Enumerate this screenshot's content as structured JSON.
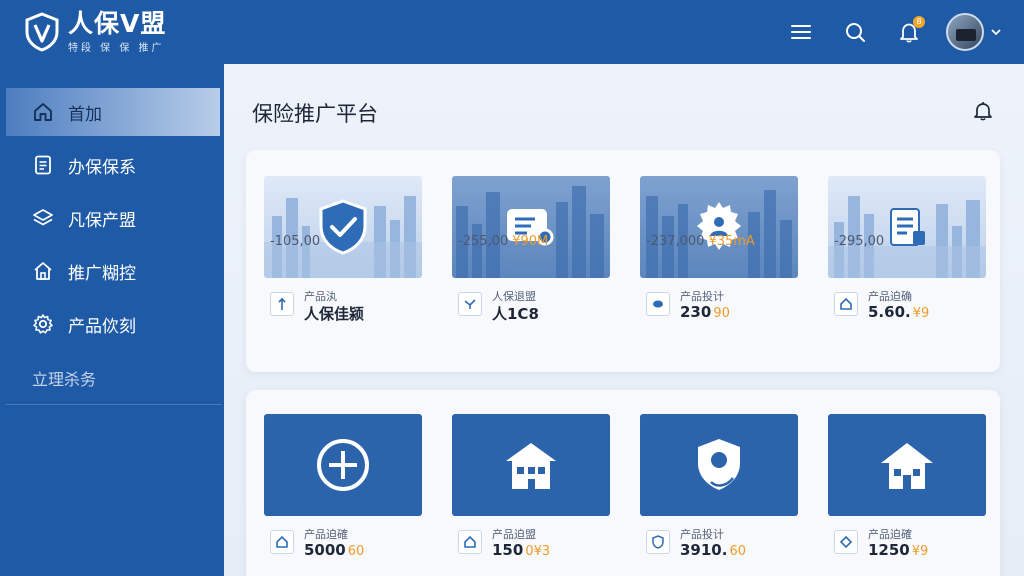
{
  "header": {
    "logo_title": "人保V盟",
    "logo_subtitle": "特段 保 保 推广",
    "icons": [
      "menu-icon",
      "search-icon",
      "bell-icon",
      "avatar",
      "chevron-down-icon"
    ],
    "notification_badge": "8"
  },
  "sidebar": {
    "items": [
      {
        "label": "首加",
        "icon": "home-icon",
        "active": true
      },
      {
        "label": "办保保系",
        "icon": "document-icon"
      },
      {
        "label": "凡保产盟",
        "icon": "layers-icon"
      },
      {
        "label": "推广糊控",
        "icon": "house-icon"
      },
      {
        "label": "产品佽刻",
        "icon": "gear-icon"
      }
    ],
    "section_label": "立理杀务"
  },
  "main": {
    "title": "保险推广平台",
    "row1": [
      {
        "label": "产品汍",
        "value": "人保佳颍",
        "value_suffix": "",
        "price": "-105,00",
        "price_suffix": "",
        "thumb_icon": "shield-check-icon"
      },
      {
        "label": "人保退盟",
        "value": "人1C8",
        "value_suffix": "",
        "price": "-255,00",
        "price_suffix": "¥90M",
        "thumb_icon": "certificate-icon"
      },
      {
        "label": "产品投计",
        "value": "230",
        "value_suffix": "90",
        "price": "-237,000",
        "price_suffix": "¥35mA",
        "thumb_icon": "gear-user-icon"
      },
      {
        "label": "产品迫确",
        "value": "5.60.",
        "value_suffix": "¥9",
        "price": "-295,00",
        "price_suffix": "",
        "thumb_icon": "document-list-icon"
      }
    ],
    "row2": [
      {
        "label": "产品迫確",
        "value": "5000",
        "value_suffix": "60",
        "thumb_icon": "plus-circle-icon"
      },
      {
        "label": "产品迫盟",
        "value": "150",
        "value_suffix": "0¥3",
        "thumb_icon": "building-icon"
      },
      {
        "label": "产品投计",
        "value": "3910.",
        "value_suffix": "60",
        "thumb_icon": "shield-location-icon"
      },
      {
        "label": "产品迫確",
        "value": "1250",
        "value_suffix": "¥9",
        "thumb_icon": "house-icon"
      }
    ]
  },
  "colors": {
    "brand": "#1f5aa6",
    "accent": "#f09a2a",
    "background": "#eef2f8"
  }
}
